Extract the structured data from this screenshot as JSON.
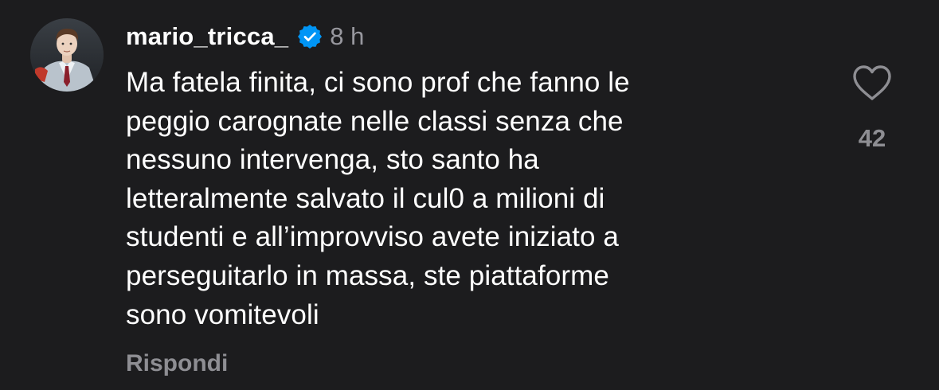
{
  "comment": {
    "username": "mario_tricca_",
    "verified_icon": "verified-badge-icon",
    "timestamp": "8 h",
    "text": "Ma fatela finita, ci sono prof che fanno le\npeggio carognate nelle classi senza che\nnessuno intervenga, sto santo ha\nletteralmente salvato il cul0 a milioni di\nstudenti e all’improvviso avete iniziato a\nperseguitarlo in massa, ste piattaforme\nsono vomitevoli",
    "reply_label": "Rispondi",
    "like_icon": "heart-outline-icon",
    "like_count": "42"
  },
  "colors": {
    "background": "#1c1c1e",
    "text_primary": "#ffffff",
    "text_secondary": "#8e8e93",
    "verified_blue": "#0095f6"
  }
}
